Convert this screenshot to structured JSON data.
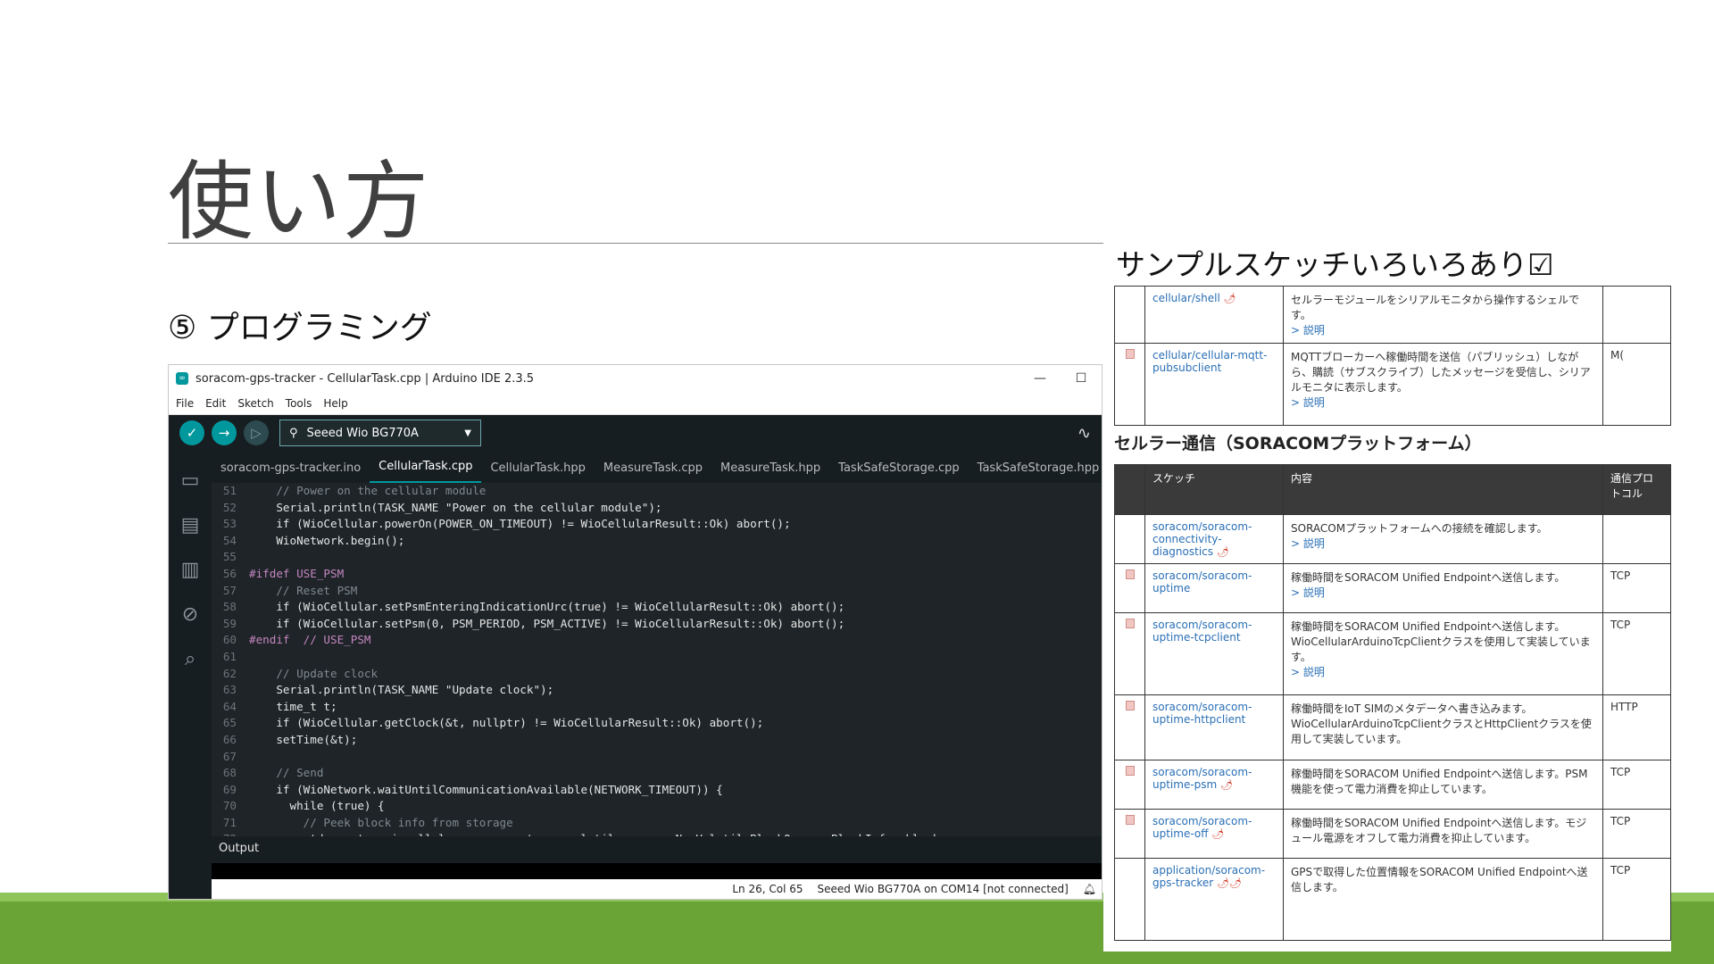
{
  "slide": {
    "title": "使い方",
    "step_label": "⑤ プログラミング",
    "panel_title": "サンプルスケッチいろいろあり☑"
  },
  "colors": {
    "accent": "#00979d",
    "band_green": "#6aa436",
    "link": "#2a6fb5"
  },
  "ide": {
    "window_title": "soracom-gps-tracker - CellularTask.cpp | Arduino IDE 2.3.5",
    "menu": [
      "File",
      "Edit",
      "Sketch",
      "Tools",
      "Help"
    ],
    "board": "Seeed Wio BG770A",
    "tabs": [
      "soracom-gps-tracker.ino",
      "CellularTask.cpp",
      "CellularTask.hpp",
      "MeasureTask.cpp",
      "MeasureTask.hpp",
      "TaskSafeStorage.cpp",
      "TaskSafeStorage.hpp"
    ],
    "active_tab": "CellularTask.cpp",
    "code": [
      {
        "n": "51",
        "t": "    // Power on the cellular module"
      },
      {
        "n": "52",
        "t": "    Serial.println(TASK_NAME \"Power on the cellular module\");"
      },
      {
        "n": "53",
        "t": "    if (WioCellular.powerOn(POWER_ON_TIMEOUT) != WioCellularResult::Ok) abort();"
      },
      {
        "n": "54",
        "t": "    WioNetwork.begin();"
      },
      {
        "n": "55",
        "t": ""
      },
      {
        "n": "56",
        "t": "#ifdef USE_PSM"
      },
      {
        "n": "57",
        "t": "    // Reset PSM"
      },
      {
        "n": "58",
        "t": "    if (WioCellular.setPsmEnteringIndicationUrc(true) != WioCellularResult::Ok) abort();"
      },
      {
        "n": "59",
        "t": "    if (WioCellular.setPsm(0, PSM_PERIOD, PSM_ACTIVE) != WioCellularResult::Ok) abort();"
      },
      {
        "n": "60",
        "t": "#endif  // USE_PSM"
      },
      {
        "n": "61",
        "t": ""
      },
      {
        "n": "62",
        "t": "    // Update clock"
      },
      {
        "n": "63",
        "t": "    Serial.println(TASK_NAME \"Update clock\");"
      },
      {
        "n": "64",
        "t": "    time_t t;"
      },
      {
        "n": "65",
        "t": "    if (WioCellular.getClock(&t, nullptr) != WioCellularResult::Ok) abort();"
      },
      {
        "n": "66",
        "t": "    setTime(&t);"
      },
      {
        "n": "67",
        "t": ""
      },
      {
        "n": "68",
        "t": "    // Send"
      },
      {
        "n": "69",
        "t": "    if (WioNetwork.waitUntilCommunicationAvailable(NETWORK_TIMEOUT)) {"
      },
      {
        "n": "70",
        "t": "      while (true) {"
      },
      {
        "n": "71",
        "t": "        // Peek block info from storage"
      },
      {
        "n": "72",
        "t": "        std::vector<wiocellular::component::nonvolatilememory::NonVolatileBlockQueue::BlockInfo> blocks;"
      }
    ],
    "output_label": "Output",
    "status_position": "Ln 26, Col 65",
    "status_board": "Seeed Wio BG770A on COM14 [not connected]"
  },
  "ref": {
    "top_rows": [
      {
        "sketch": "cellular/shell",
        "desc": "セルラーモジュールをシリアルモニタから操作するシェルです。",
        "link": "> 説明",
        "proto": ""
      },
      {
        "sketch": "cellular/cellular-mqtt-pubsubclient",
        "desc": "MQTTブローカーへ稼働時間を送信（パブリッシュ）しながら、購読（サブスクライブ）したメッセージを受信し、シリアルモニタに表示します。",
        "link": "> 説明",
        "proto": "M("
      }
    ],
    "section_title": "セルラー通信（SORACOMプラットフォーム）",
    "header": {
      "sketch": "スケッチ",
      "content": "内容",
      "proto": "通信プロトコル"
    },
    "rows": [
      {
        "sketch": "soracom/soracom-connectivity-diagnostics",
        "desc": "SORACOMプラットフォームへの接続を確認します。",
        "link": "> 説明",
        "proto": ""
      },
      {
        "sketch": "soracom/soracom-uptime",
        "desc": "稼働時間をSORACOM Unified Endpointへ送信します。",
        "link": "> 説明",
        "proto": "TCP"
      },
      {
        "sketch": "soracom/soracom-uptime-tcpclient",
        "desc": "稼働時間をSORACOM Unified Endpointへ送信します。WioCellularArduinoTcpClientクラスを使用して実装しています。",
        "link": "> 説明",
        "proto": "TCP"
      },
      {
        "sketch": "soracom/soracom-uptime-httpclient",
        "desc": "稼働時間をIoT SIMのメタデータへ書き込みます。WioCellularArduinoTcpClientクラスとHttpClientクラスを使用して実装しています。",
        "link": "",
        "proto": "HTTP"
      },
      {
        "sketch": "soracom/soracom-uptime-psm",
        "desc": "稼働時間をSORACOM Unified Endpointへ送信します。PSM機能を使って電力消費を抑止しています。",
        "link": "",
        "proto": "TCP"
      },
      {
        "sketch": "soracom/soracom-uptime-off",
        "desc": "稼働時間をSORACOM Unified Endpointへ送信します。モジュール電源をオフして電力消費を抑止しています。",
        "link": "",
        "proto": "TCP"
      },
      {
        "sketch": "application/soracom-gps-tracker",
        "desc": "GPSで取得した位置情報をSORACOM Unified Endpointへ送信します。",
        "link": "",
        "proto": "TCP"
      }
    ]
  }
}
